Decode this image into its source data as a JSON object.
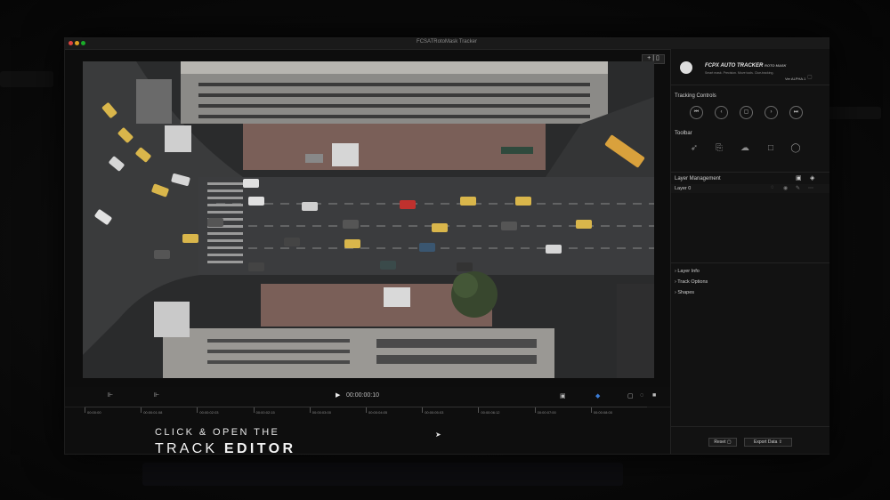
{
  "window": {
    "title": "FCSATRotoMask Tracker"
  },
  "viewer": {
    "view_button": "+ | ▯"
  },
  "brand": {
    "name": "FCPX AUTO TRACKER",
    "suffix": "ROTO MASK",
    "tagline": "Smart mask. Precision. Move tools. Clue-tracking.",
    "version": "Ver ALPHA.1"
  },
  "tracking_controls": {
    "title": "Tracking Controls",
    "buttons": [
      "⏮",
      "‹",
      "▢",
      "›",
      "⏭"
    ]
  },
  "toolbar": {
    "title": "Toolbar",
    "tools": [
      "pointer-tool",
      "rectangle-pen-tool",
      "freehand-tool",
      "square-tool",
      "ellipse-tool"
    ]
  },
  "layer_management": {
    "title": "Layer Management",
    "layers": [
      {
        "name": "Layer 0"
      }
    ]
  },
  "sections": [
    {
      "label": "Layer Info"
    },
    {
      "label": "Track Options"
    },
    {
      "label": "Shapes"
    }
  ],
  "buttons": {
    "reset": "Reset",
    "export": "Export Data"
  },
  "timeline": {
    "timecode": "00:00:00:10",
    "labels": [
      "00:00:00",
      "00:00:01:08",
      "00:00:02:03",
      "00:00:02:15",
      "00:00:03:00",
      "00:00:04:05",
      "00:00:05:03",
      "00:00:06:12",
      "00:00:07:00",
      "00:00:08:00"
    ]
  },
  "caption": {
    "line1": "CLICK & OPEN THE",
    "line2_a": "TRACK",
    "line2_b": "EDITOR"
  },
  "colors": {
    "accent": "#cfcfcf",
    "background": "#070707",
    "panel": "#121212"
  }
}
